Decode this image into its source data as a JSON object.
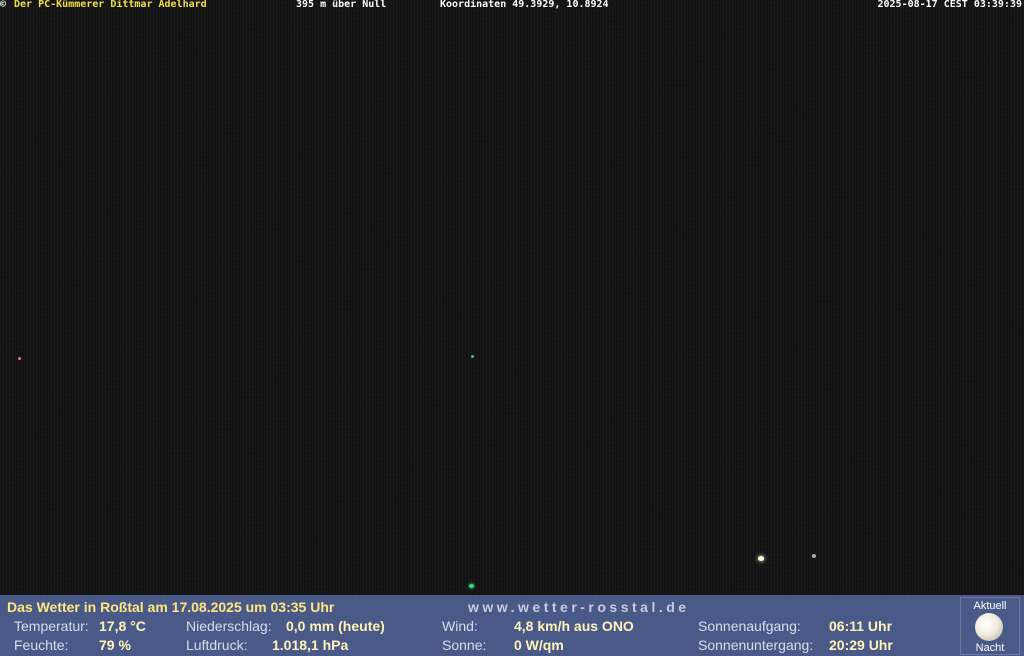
{
  "overlay": {
    "copyright_symbol": "©",
    "owner": "Der PC-Kümmerer Dittmar Adelhard",
    "altitude": "395 m über Null",
    "coordinates": "Koordinaten 49.3929, 10.8924",
    "timestamp": "2025-08-17 CEST 03:39:39"
  },
  "panel": {
    "headline": "Das Wetter in Roßtal am 17.08.2025 um 03:35 Uhr",
    "website": "www.wetter-rosstal.de",
    "temperature": {
      "label": "Temperatur:",
      "value": "17,8 °C"
    },
    "humidity": {
      "label": "Feuchte:",
      "value": "79 %"
    },
    "precipitation": {
      "label": "Niederschlag:",
      "value": "0,0 mm (heute)"
    },
    "pressure": {
      "label": "Luftdruck:",
      "value": "1.018,1 hPa"
    },
    "wind": {
      "label": "Wind:",
      "value": "4,8 km/h aus ONO"
    },
    "sun": {
      "label": "Sonne:",
      "value": "0 W/qm"
    },
    "sunrise": {
      "label": "Sonnenaufgang:",
      "value": "06:11 Uhr"
    },
    "sunset": {
      "label": "Sonnenuntergang:",
      "value": "20:29 Uhr"
    },
    "moon": {
      "top_caption": "Aktuell",
      "bottom_caption": "Nacht",
      "icon": "full-moon-icon"
    }
  },
  "colors": {
    "panel_background": "#4a5a88",
    "headline": "#ffe680",
    "owner": "#f0e040"
  }
}
